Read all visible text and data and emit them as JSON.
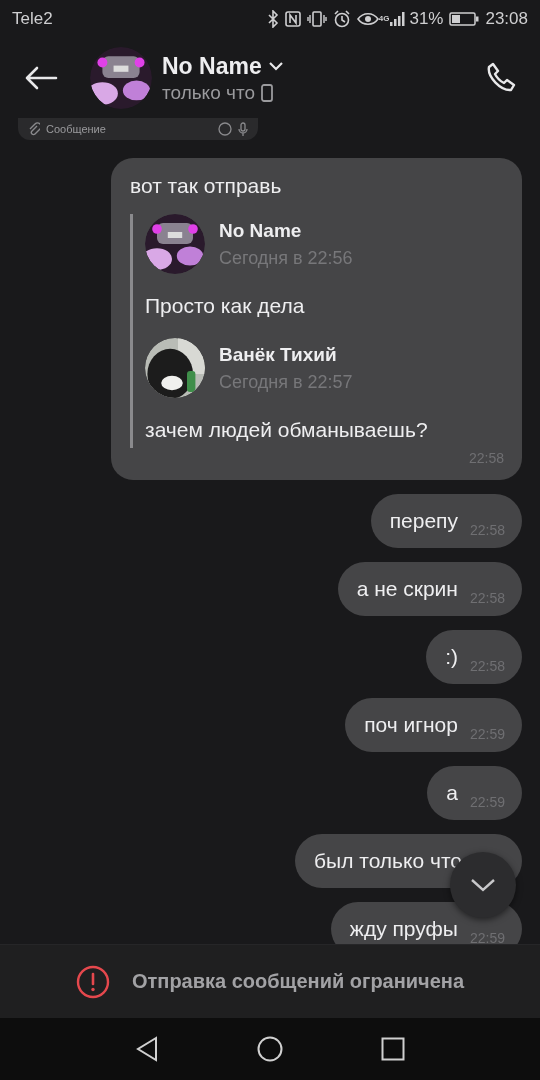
{
  "status_bar": {
    "carrier": "Tele2",
    "network": "4G",
    "battery": "31%",
    "time": "23:08"
  },
  "header": {
    "name": "No Name",
    "status": "только что"
  },
  "cut_message": {
    "input_placeholder": "Сообщение"
  },
  "messages": [
    {
      "kind": "forward",
      "text": "вот так отправь",
      "time": "22:58",
      "quotes": [
        {
          "author": "No Name",
          "date": "Сегодня в 22:56",
          "text": "Просто как дела"
        },
        {
          "author": "Ванёк Тихий",
          "date": "Сегодня в 22:57",
          "text": "зачем людей обманываешь?"
        }
      ]
    },
    {
      "kind": "text",
      "text": "перепу",
      "time": "22:58"
    },
    {
      "kind": "text",
      "text": "а не скрин",
      "time": "22:58"
    },
    {
      "kind": "text",
      "text": ":)",
      "time": "22:58"
    },
    {
      "kind": "text",
      "text": "поч игнор",
      "time": "22:59"
    },
    {
      "kind": "text",
      "text": "а",
      "time": "22:59"
    },
    {
      "kind": "text",
      "text": "был только что"
    },
    {
      "kind": "text",
      "text": "жду пруфы",
      "time": "22:59"
    }
  ],
  "restriction_notice": "Отправка сообщений ограничена"
}
